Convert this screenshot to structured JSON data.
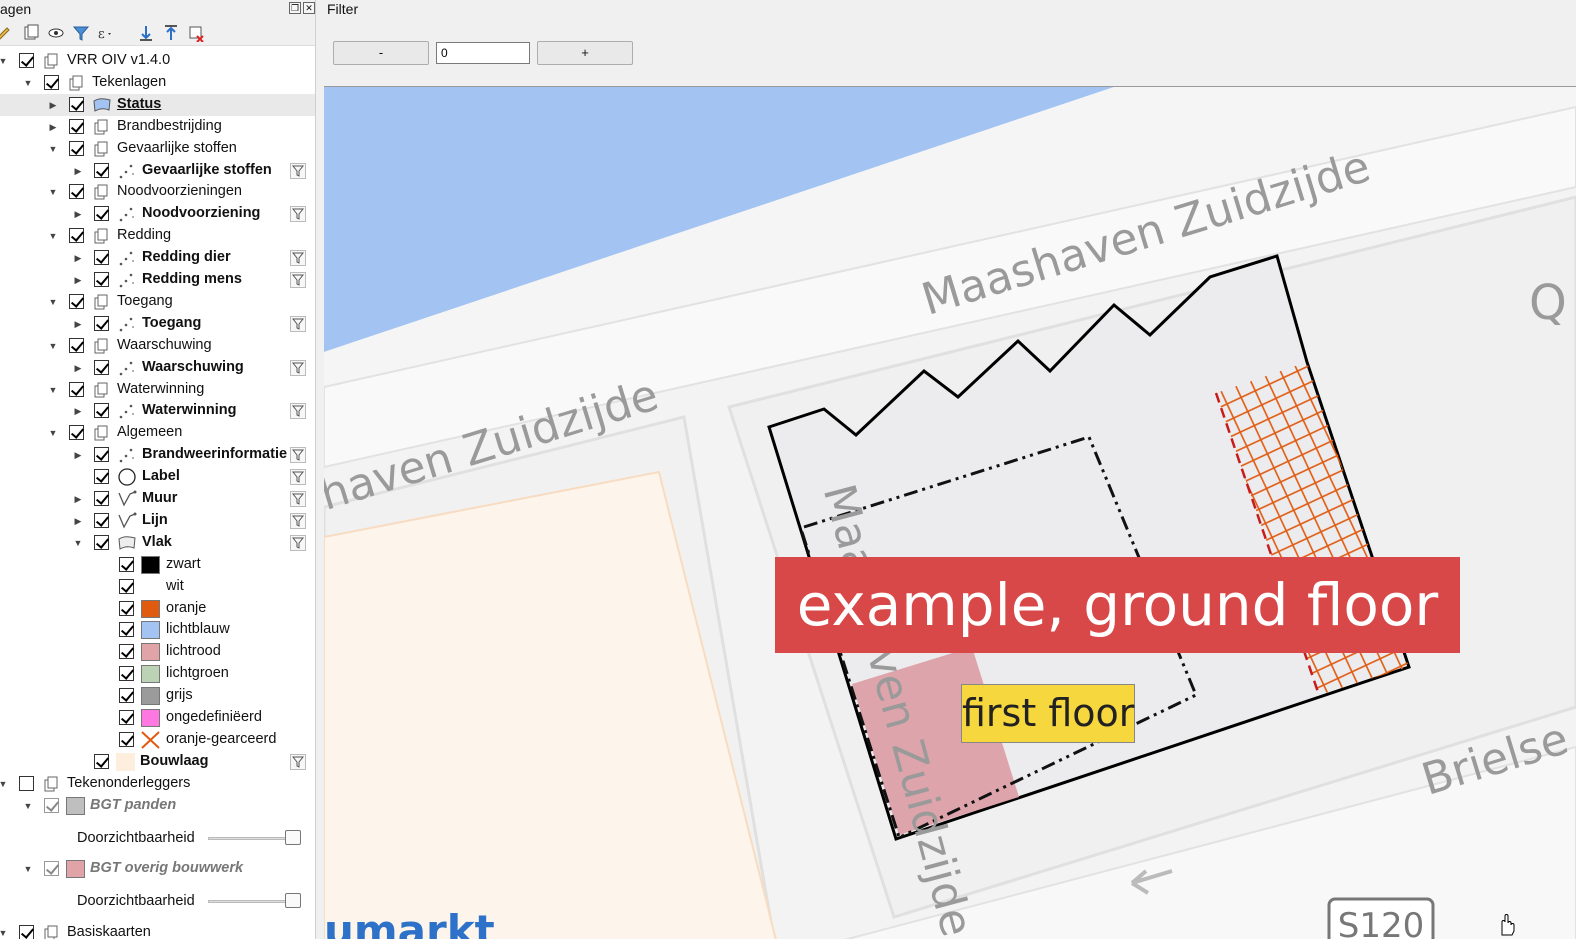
{
  "layers_panel": {
    "title": "agen",
    "toolbar_icons": [
      "style-manager-icon",
      "add-group-icon",
      "eye-icon",
      "filter-legend-icon",
      "expression-filter-icon",
      "expand-all-icon",
      "collapse-all-icon",
      "remove-layer-icon"
    ],
    "tree": [
      {
        "label": "VRR OIV v1.4.0",
        "level": 0,
        "expanded": true,
        "checked": true,
        "icon": "group-icon",
        "style": "normal"
      },
      {
        "label": "Tekenlagen",
        "level": 1,
        "expanded": true,
        "checked": true,
        "icon": "group-icon",
        "style": "normal"
      },
      {
        "label": "Status",
        "level": 2,
        "expanded": false,
        "checked": true,
        "icon": "polygon-layer-icon",
        "style": "bold-underline",
        "selected": true
      },
      {
        "label": "Brandbestrijding",
        "level": 2,
        "expanded": false,
        "checked": true,
        "icon": "group-icon",
        "style": "normal"
      },
      {
        "label": "Gevaarlijke stoffen",
        "level": 2,
        "expanded": true,
        "checked": true,
        "icon": "group-icon",
        "style": "normal"
      },
      {
        "label": "Gevaarlijke stoffen",
        "level": 3,
        "expanded": false,
        "checked": true,
        "icon": "point-layer-icon",
        "style": "bold",
        "filter": true
      },
      {
        "label": "Noodvoorzieningen",
        "level": 2,
        "expanded": true,
        "checked": true,
        "icon": "group-icon",
        "style": "normal"
      },
      {
        "label": "Noodvoorziening",
        "level": 3,
        "expanded": false,
        "checked": true,
        "icon": "point-layer-icon",
        "style": "bold",
        "filter": true
      },
      {
        "label": "Redding",
        "level": 2,
        "expanded": true,
        "checked": true,
        "icon": "group-icon",
        "style": "normal"
      },
      {
        "label": "Redding dier",
        "level": 3,
        "expanded": false,
        "checked": true,
        "icon": "point-layer-icon",
        "style": "bold",
        "filter": true
      },
      {
        "label": "Redding mens",
        "level": 3,
        "expanded": false,
        "checked": true,
        "icon": "point-layer-icon",
        "style": "bold",
        "filter": true
      },
      {
        "label": "Toegang",
        "level": 2,
        "expanded": true,
        "checked": true,
        "icon": "group-icon",
        "style": "normal"
      },
      {
        "label": "Toegang",
        "level": 3,
        "expanded": false,
        "checked": true,
        "icon": "point-layer-icon",
        "style": "bold",
        "filter": true
      },
      {
        "label": "Waarschuwing",
        "level": 2,
        "expanded": true,
        "checked": true,
        "icon": "group-icon",
        "style": "normal"
      },
      {
        "label": "Waarschuwing",
        "level": 3,
        "expanded": false,
        "checked": true,
        "icon": "point-layer-icon",
        "style": "bold",
        "filter": true
      },
      {
        "label": "Waterwinning",
        "level": 2,
        "expanded": true,
        "checked": true,
        "icon": "group-icon",
        "style": "normal"
      },
      {
        "label": "Waterwinning",
        "level": 3,
        "expanded": false,
        "checked": true,
        "icon": "point-layer-icon",
        "style": "bold",
        "filter": true
      },
      {
        "label": "Algemeen",
        "level": 2,
        "expanded": true,
        "checked": true,
        "icon": "group-icon",
        "style": "normal"
      },
      {
        "label": "Brandweerinformatie",
        "level": 3,
        "expanded": false,
        "checked": true,
        "icon": "point-layer-icon",
        "style": "bold",
        "filter": true
      },
      {
        "label": "Label",
        "level": 3,
        "expanded": null,
        "checked": true,
        "icon": "circle-icon",
        "style": "bold",
        "filter": true
      },
      {
        "label": "Muur",
        "level": 3,
        "expanded": false,
        "checked": true,
        "icon": "line-layer-icon",
        "style": "bold",
        "filter": true
      },
      {
        "label": "Lijn",
        "level": 3,
        "expanded": false,
        "checked": true,
        "icon": "line-layer-icon",
        "style": "bold",
        "filter": true
      },
      {
        "label": "Vlak",
        "level": 3,
        "expanded": true,
        "checked": true,
        "icon": "polygon-layer-icon",
        "style": "bold",
        "filter": true
      },
      {
        "label": "zwart",
        "level": 4,
        "checked": true,
        "swatch": "#000000",
        "style": "normal"
      },
      {
        "label": "wit",
        "level": 4,
        "checked": true,
        "swatch": "#ffffff",
        "style": "normal"
      },
      {
        "label": "oranje",
        "level": 4,
        "checked": true,
        "swatch": "#e05a10",
        "style": "normal"
      },
      {
        "label": "lichtblauw",
        "level": 4,
        "checked": true,
        "swatch": "#a3c4f3",
        "style": "normal"
      },
      {
        "label": "lichtrood",
        "level": 4,
        "checked": true,
        "swatch": "#e0a3a8",
        "style": "normal"
      },
      {
        "label": "lichtgroen",
        "level": 4,
        "checked": true,
        "swatch": "#bcd2b4",
        "style": "normal"
      },
      {
        "label": "grijs",
        "level": 4,
        "checked": true,
        "swatch": "#9b9b9b",
        "style": "normal"
      },
      {
        "label": "ongedefiniëerd",
        "level": 4,
        "checked": true,
        "swatch": "#ff77e0",
        "style": "normal"
      },
      {
        "label": "oranje-gearceerd",
        "level": 4,
        "checked": true,
        "swatch": "hatch",
        "style": "normal"
      },
      {
        "label": "Bouwlaag",
        "level": 3,
        "expanded": null,
        "checked": true,
        "swatch": "#fdeedd",
        "style": "bold",
        "filter": true
      },
      {
        "label": "Tekenonderleggers",
        "level": 0,
        "expanded": true,
        "checked": false,
        "icon": "group-icon",
        "style": "normal"
      },
      {
        "label": "BGT panden",
        "level": 1,
        "expanded": true,
        "checked": true,
        "grey": true,
        "swatch": "#bfbfbf",
        "style": "grey-italic"
      },
      {
        "label": "Doorzichtbaarheid",
        "level": 2,
        "slider": true,
        "style": "normal"
      },
      {
        "label": "BGT overig bouwwerk",
        "level": 1,
        "expanded": true,
        "checked": true,
        "grey": true,
        "swatch": "#e0a3a8",
        "style": "grey-italic"
      },
      {
        "label": "Doorzichtbaarheid",
        "level": 2,
        "slider": true,
        "style": "normal"
      },
      {
        "label": "Basiskaarten",
        "level": 0,
        "expanded": true,
        "checked": true,
        "icon": "group-icon",
        "style": "normal"
      }
    ]
  },
  "filter_panel": {
    "title": "Filter",
    "minus_label": "-",
    "value": "0",
    "plus_label": "+"
  },
  "map": {
    "title_label": "example, ground floor",
    "floor_label": "first floor",
    "streets": [
      "Maashaven Zuidzijde",
      "haven Zuidzijde",
      "Maashaven Zuidzijde",
      "Brielse",
      "Q",
      "umarkt"
    ],
    "road_sign": "S120",
    "water_color": "#a3c4f3",
    "label_red": "#d94848",
    "label_yellow": "#f6d73e"
  }
}
